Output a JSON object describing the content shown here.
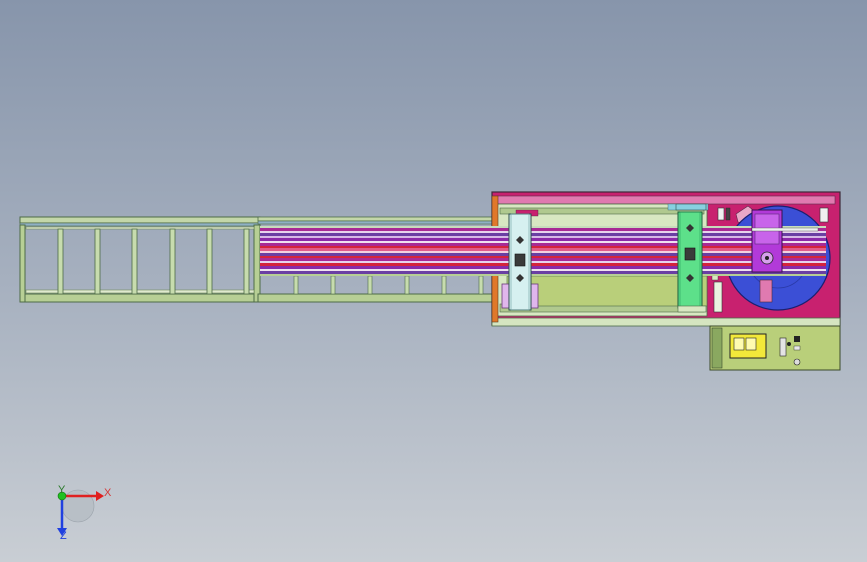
{
  "viewport": {
    "background_top": "#8795ab",
    "background_bottom": "#c9ced4"
  },
  "triad": {
    "x_label": "X",
    "y_label": "Y",
    "z_label": "Z",
    "x_color": "#e02020",
    "y_color": "#20c020",
    "z_color": "#2040e0"
  },
  "model": {
    "colors": {
      "frame_green": "#b7cf95",
      "frame_dark": "#6e8a58",
      "roller_stripe_magenta": "#a82a95",
      "roller_stripe_purple": "#6a3fa3",
      "roller_stripe_red": "#d4243c",
      "roller_stripe_pink": "#e05a8a",
      "housing_magenta": "#c8216f",
      "turntable_blue": "#3b4fd6",
      "motor_purple": "#b23ad9",
      "carriage_cyan": "#d6f0f0",
      "carriage_green": "#5de08a",
      "panel_yellow": "#f2e83a",
      "orange_accent": "#e0782a"
    },
    "parts": [
      "roller-conveyor-frame",
      "belt-conveyor-bed",
      "carriage-left",
      "carriage-right",
      "wrapping-housing",
      "turntable",
      "motor-unit",
      "control-box"
    ]
  }
}
